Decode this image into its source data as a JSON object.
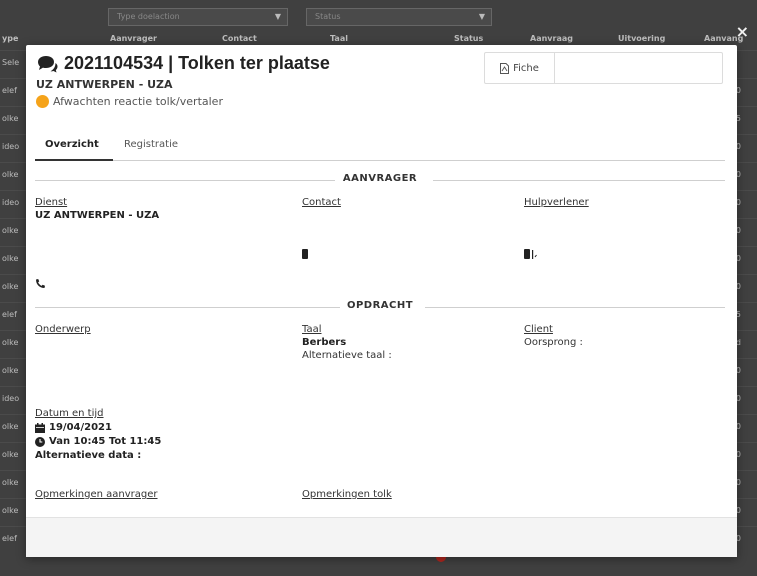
{
  "background": {
    "filters": [
      "Type doelaction",
      "Status"
    ],
    "headers": [
      "ype",
      "Aanvrager",
      "Contact",
      "Taal",
      "Status",
      "Aanvraag",
      "Uitvoering",
      "Aanvang"
    ],
    "row_prefixes": [
      "Sele",
      "elef",
      "olke",
      "ideo",
      "olke",
      "ideo",
      "olke",
      "olke",
      "olke",
      "elef",
      "olke",
      "olke",
      "ideo",
      "olke",
      "olke",
      "olke",
      "olke",
      "elef"
    ],
    "row_suffixes": [
      "",
      "0",
      "5",
      "0",
      "0",
      "0",
      "0",
      "0",
      "0",
      "5",
      "d",
      "0",
      "0",
      "0",
      "0",
      "0",
      "0",
      "0"
    ]
  },
  "modal": {
    "title": "2021104534 | Tolken ter plaatse",
    "subtitle": "UZ ANTWERPEN - UZA",
    "status": "Afwachten reactie tolk/vertaler",
    "status_color": "#f5a31a",
    "fiche_label": "Fiche",
    "tabs": [
      {
        "label": "Overzicht",
        "active": true
      },
      {
        "label": "Registratie",
        "active": false
      }
    ],
    "sections": {
      "aanvrager": "AANVRAGER",
      "opdracht": "OPDRACHT"
    },
    "aanvrager": {
      "dienst_label": "Dienst",
      "dienst_value": "UZ ANTWERPEN - UZA",
      "contact_label": "Contact",
      "hulpverlener_label": "Hulpverlener"
    },
    "opdracht": {
      "onderwerp_label": "Onderwerp",
      "taal_label": "Taal",
      "taal_value": "Berbers",
      "alt_taal_label": "Alternatieve taal :",
      "client_label": "Client",
      "oorsprong_label": "Oorsprong :",
      "datum_label": "Datum en tijd",
      "datum_value": "19/04/2021",
      "tijd_value": "Van 10:45 Tot 11:45",
      "alt_data_label": "Alternatieve data :",
      "opm_aanvrager_label": "Opmerkingen aanvrager",
      "opm_tolk_label": "Opmerkingen tolk"
    },
    "close_symbol": "×"
  }
}
